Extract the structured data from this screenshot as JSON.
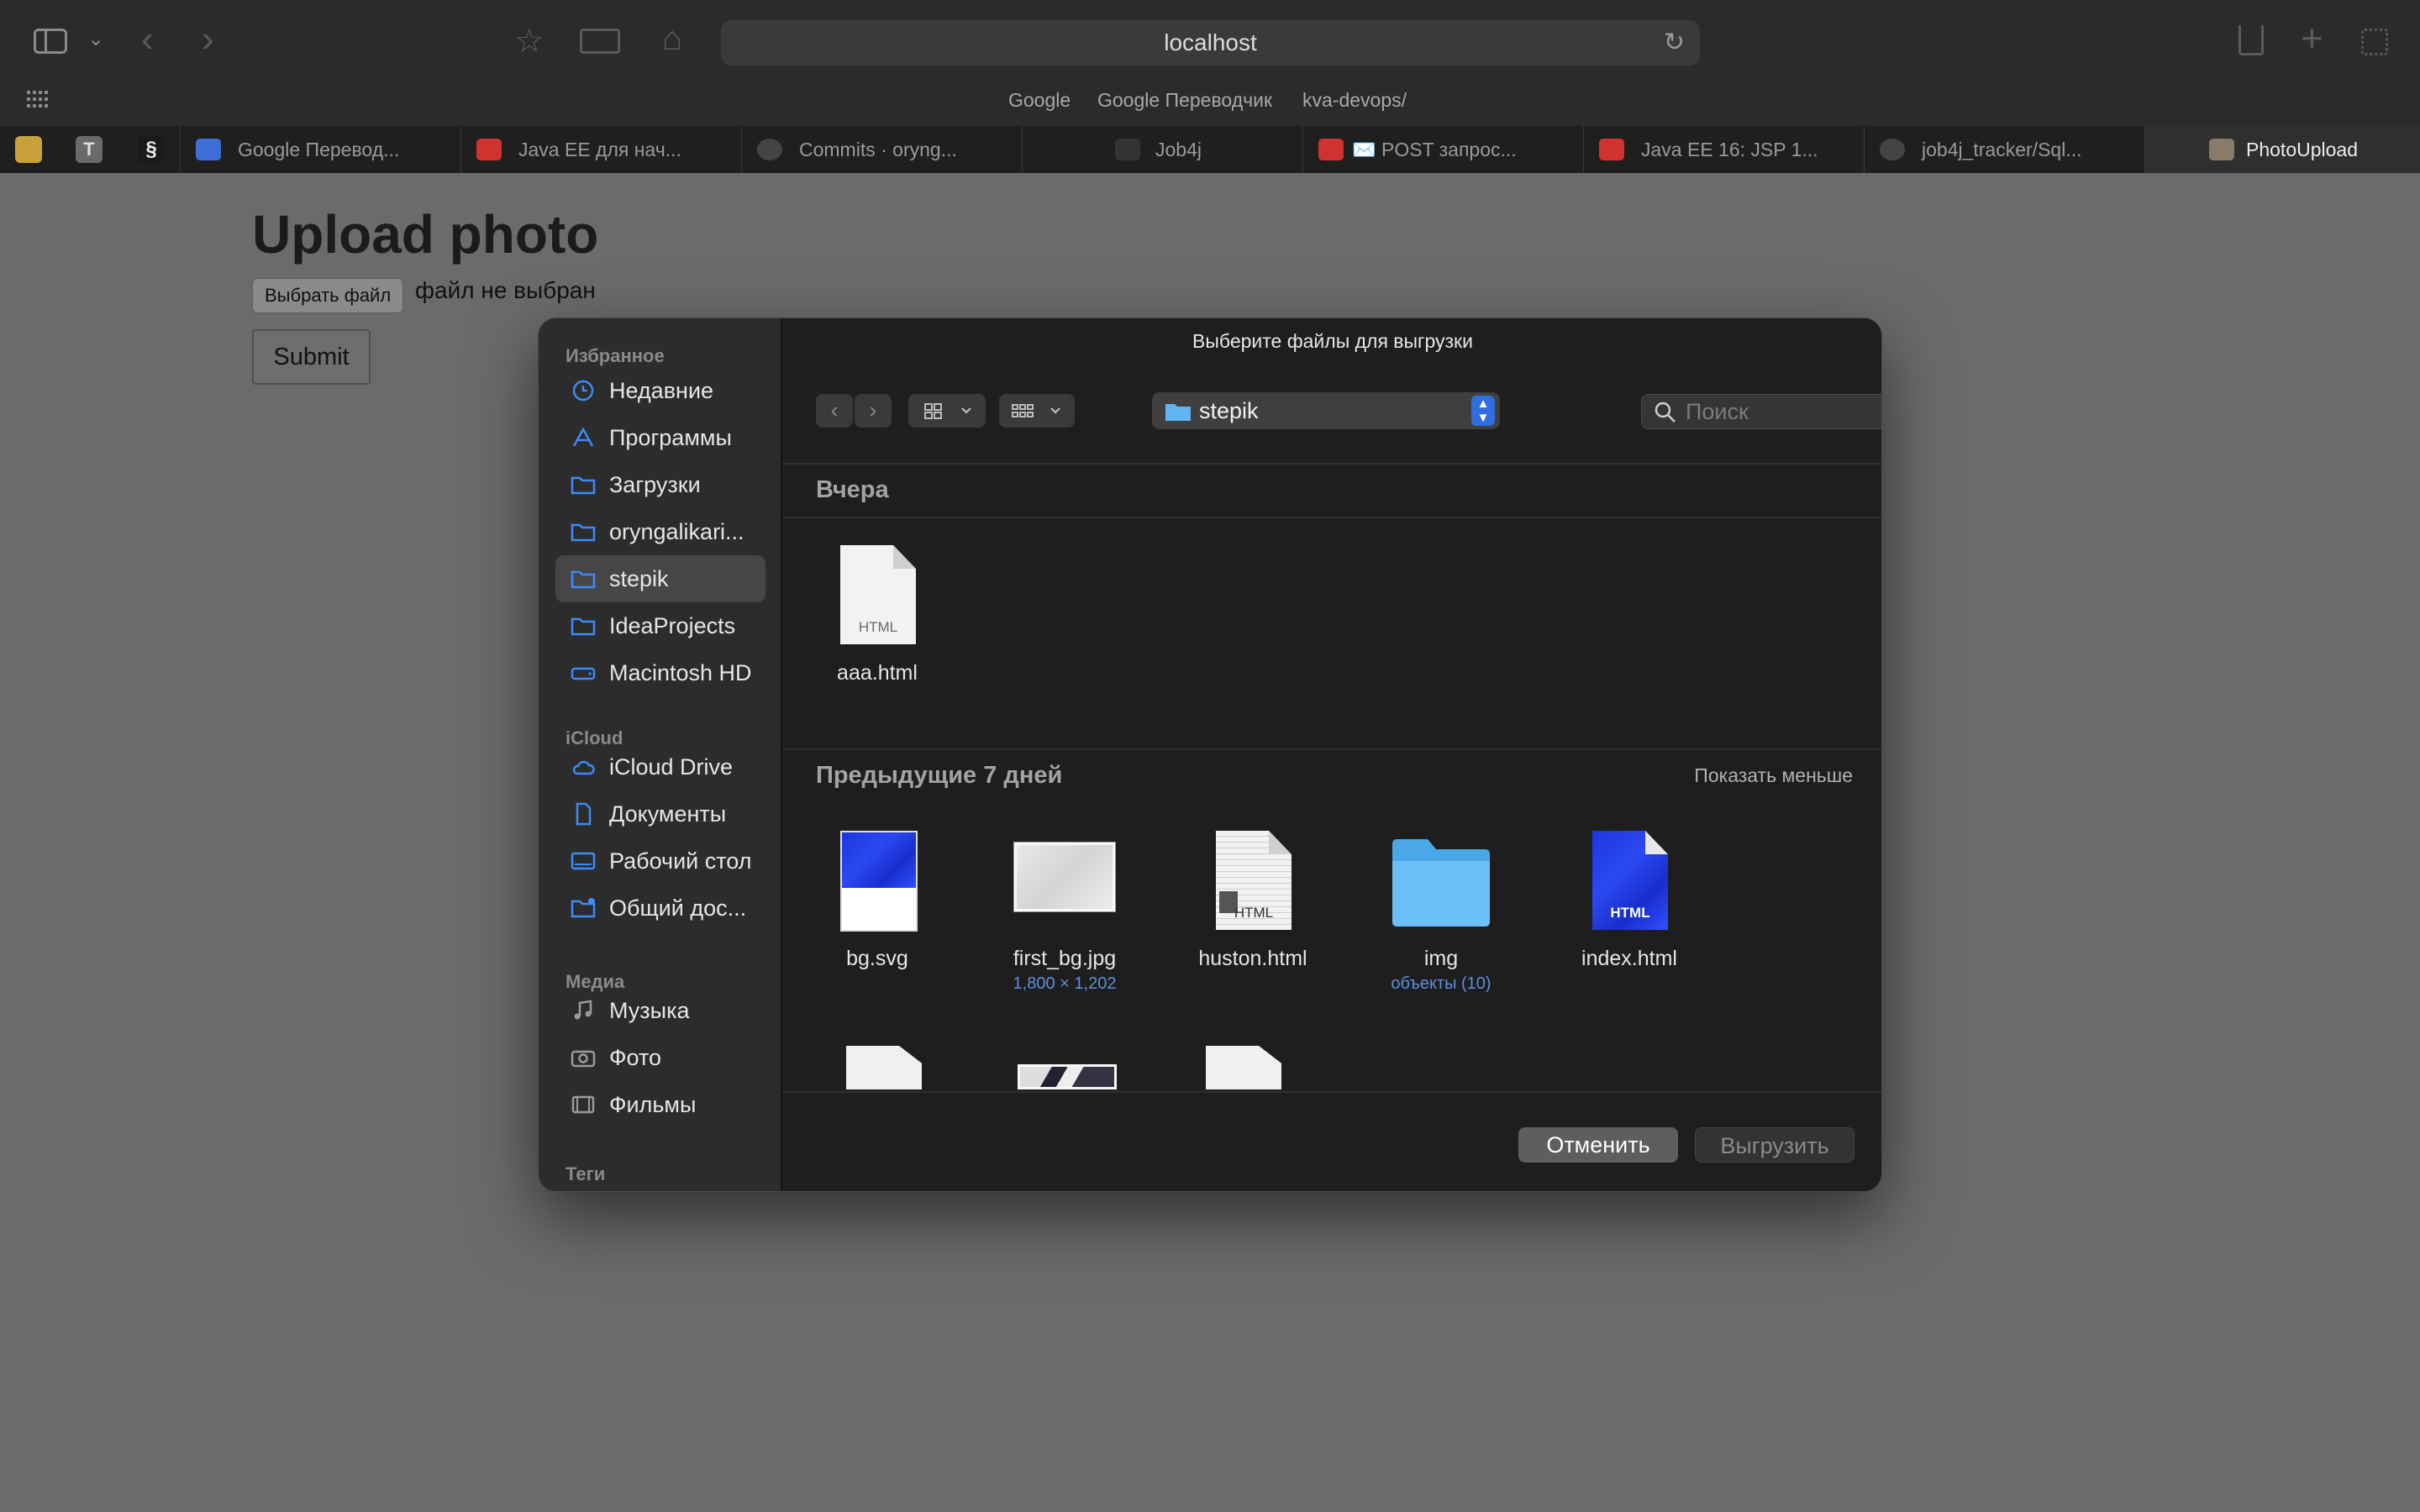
{
  "browser": {
    "address": "localhost",
    "favorites": [
      "Google",
      "Google Переводчик",
      "kva-devops/"
    ],
    "tabs": [
      {
        "label": "Google Перевод...",
        "color": "#3f6fd6"
      },
      {
        "label": "Java EE для нач...",
        "color": "#d0322f"
      },
      {
        "label": "Commits · oryng...",
        "color": "#444444"
      },
      {
        "label": "Job4j",
        "color": "#333333"
      },
      {
        "label": "✉️ POST запрос...",
        "color": "#d0322f"
      },
      {
        "label": "Java EE 16: JSP 1...",
        "color": "#d0322f"
      },
      {
        "label": "job4j_tracker/Sql...",
        "color": "#444444"
      },
      {
        "label": "PhotoUpload",
        "color": "#8a7a6a"
      }
    ]
  },
  "page": {
    "title": "Upload photo",
    "choose_file_label": "Выбрать файл",
    "no_file_text": "файл не выбран",
    "submit_label": "Submit"
  },
  "dialog": {
    "title": "Выберите файлы для выгрузки",
    "location": "stepik",
    "search_placeholder": "Поиск",
    "sidebar": {
      "favorites_header": "Избранное",
      "favorites": [
        {
          "label": "Недавние",
          "icon": "clock-icon"
        },
        {
          "label": "Программы",
          "icon": "apps-icon"
        },
        {
          "label": "Загрузки",
          "icon": "folder-icon"
        },
        {
          "label": "oryngalikari...",
          "icon": "folder-icon"
        },
        {
          "label": "stepik",
          "icon": "folder-icon",
          "selected": true
        },
        {
          "label": "IdeaProjects",
          "icon": "folder-icon"
        },
        {
          "label": "Macintosh HD",
          "icon": "disk-icon"
        }
      ],
      "icloud_header": "iCloud",
      "icloud": [
        {
          "label": "iCloud Drive",
          "icon": "cloud-icon"
        },
        {
          "label": "Документы",
          "icon": "document-icon"
        },
        {
          "label": "Рабочий стол",
          "icon": "desktop-icon"
        },
        {
          "label": "Общий дос...",
          "icon": "shared-folder-icon"
        }
      ],
      "media_header": "Медиа",
      "media": [
        {
          "label": "Музыка",
          "icon": "music-icon"
        },
        {
          "label": "Фото",
          "icon": "camera-icon"
        },
        {
          "label": "Фильмы",
          "icon": "film-icon"
        }
      ],
      "tags_header": "Теги"
    },
    "groups": {
      "yesterday": "Вчера",
      "previous": "Предыдущие 7 дней",
      "show_less": "Показать меньше"
    },
    "yesterday_files": [
      {
        "name": "aaa.html",
        "thumb_label": "HTML"
      }
    ],
    "previous_files": [
      {
        "name": "bg.svg",
        "meta": ""
      },
      {
        "name": "first_bg.jpg",
        "meta": "1,800 × 1,202"
      },
      {
        "name": "huston.html",
        "meta": "",
        "thumb_label": "HTML"
      },
      {
        "name": "img",
        "meta": "объекты (10)"
      },
      {
        "name": "index.html",
        "meta": "",
        "thumb_label": "HTML"
      }
    ],
    "cancel_label": "Отменить",
    "upload_label": "Выгрузить"
  }
}
